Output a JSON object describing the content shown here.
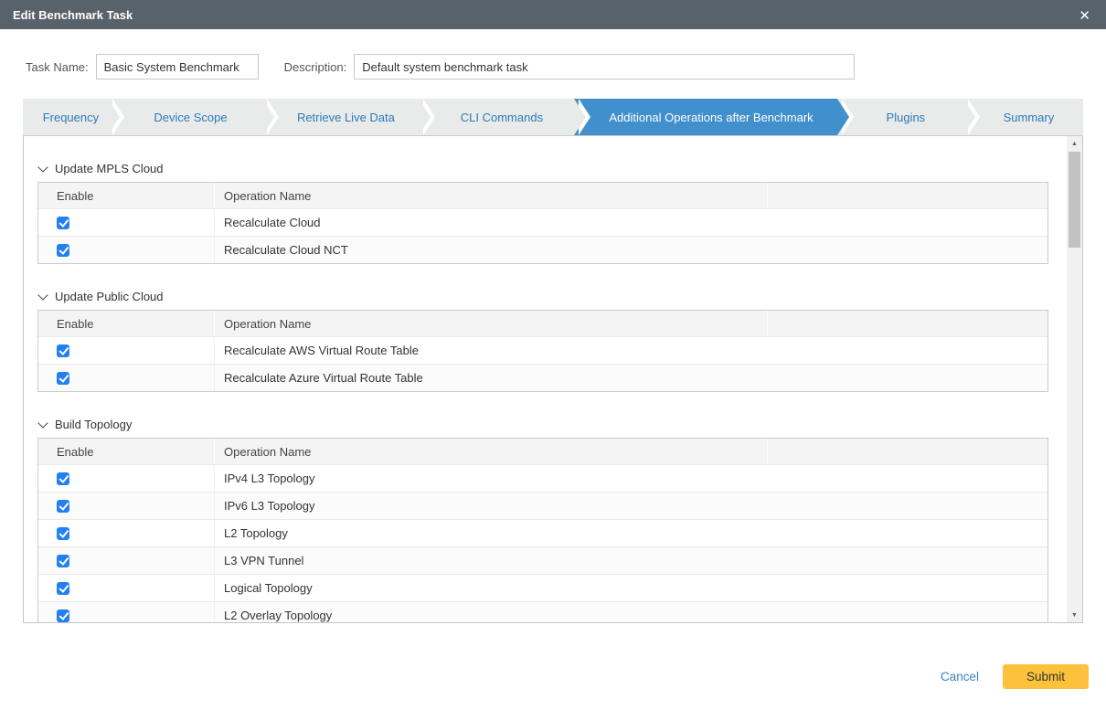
{
  "dialog": {
    "title": "Edit Benchmark Task",
    "close_icon": "✕"
  },
  "form": {
    "task_name": {
      "label": "Task Name:",
      "value": "Basic System Benchmark"
    },
    "description": {
      "label": "Description:",
      "value": "Default system benchmark task"
    }
  },
  "wizard": {
    "active_tab": "Additional Operations after Benchmark",
    "tabs": [
      {
        "label": "Frequency",
        "active": false
      },
      {
        "label": "Device Scope",
        "active": false
      },
      {
        "label": "Retrieve Live Data",
        "active": false
      },
      {
        "label": "CLI Commands",
        "active": false
      },
      {
        "label": "Additional Operations after Benchmark",
        "active": true
      },
      {
        "label": "Plugins",
        "active": false
      },
      {
        "label": "Summary",
        "active": false
      }
    ]
  },
  "sections": [
    {
      "title": "Update MPLS Cloud",
      "collapse_icon": "chevron-down-icon",
      "columns": [
        "Enable",
        "Operation Name",
        ""
      ],
      "rows": [
        {
          "enabled": true,
          "operation": "Recalculate Cloud"
        },
        {
          "enabled": true,
          "operation": "Recalculate Cloud NCT"
        }
      ]
    },
    {
      "title": "Update Public Cloud",
      "collapse_icon": "chevron-down-icon",
      "columns": [
        "Enable",
        "Operation Name",
        ""
      ],
      "rows": [
        {
          "enabled": true,
          "operation": "Recalculate AWS Virtual Route Table"
        },
        {
          "enabled": true,
          "operation": "Recalculate Azure Virtual Route Table"
        }
      ]
    },
    {
      "title": "Build Topology",
      "collapse_icon": "chevron-down-icon",
      "columns": [
        "Enable",
        "Operation Name",
        ""
      ],
      "rows": [
        {
          "enabled": true,
          "operation": "IPv4 L3 Topology"
        },
        {
          "enabled": true,
          "operation": "IPv6 L3 Topology"
        },
        {
          "enabled": true,
          "operation": "L2 Topology"
        },
        {
          "enabled": true,
          "operation": "L3 VPN Tunnel"
        },
        {
          "enabled": true,
          "operation": "Logical Topology"
        },
        {
          "enabled": true,
          "operation": "L2 Overlay Topology"
        }
      ]
    }
  ],
  "scrollbar": {
    "up_icon": "▲",
    "down_icon": "▼"
  },
  "footer": {
    "cancel_label": "Cancel",
    "submit_label": "Submit"
  },
  "colors": {
    "titlebar": "#57626b",
    "active_tab_blue": "#418fcc",
    "tab_text_blue": "#2b7cba",
    "checkbox_blue": "#2380f2",
    "submit_yellow": "#fcc23c",
    "cancel_link_blue": "#3b82c4"
  }
}
